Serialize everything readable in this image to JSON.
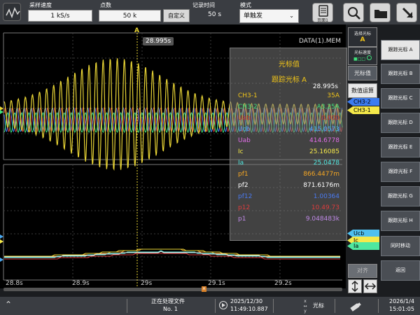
{
  "topbar": {
    "sample_rate": {
      "label": "采样速度",
      "value": "1 kS/s"
    },
    "points": {
      "label": "点数",
      "value": "50 k"
    },
    "custom_label": "自定义",
    "record_time": {
      "label": "记录时间",
      "value": "50 s"
    },
    "mode": {
      "label": "模式",
      "value": "单触发"
    },
    "page_button_label": "页面1"
  },
  "scope": {
    "filename": "DATA(1).MEM",
    "cursor_marker": "A",
    "cursor_time": "28.995s",
    "time_ticks": [
      "28.8s",
      "28.9s",
      "29s",
      "29.1s",
      "29.2s"
    ],
    "right_tags_top": [
      "CH3-2",
      "CH3-1"
    ],
    "right_tags_bottom": [
      "Ucb",
      "Ic",
      "Ia"
    ],
    "scroll_marker": "A"
  },
  "popup": {
    "title": "光标值",
    "subtitle": "跟踪光标 A",
    "time": "28.995s",
    "rows": [
      {
        "name": "CH3-1",
        "value": "35A",
        "color": "#f0c419"
      },
      {
        "name": "CH3-2",
        "value": "A3.25A",
        "color": "#3fe07a"
      },
      {
        "name": "Uab",
        "value": "0.000",
        "color": "#c0392b"
      },
      {
        "name": "Ucb",
        "value": "415.0573",
        "color": "#4aa8f0"
      },
      {
        "name": "Uab",
        "value": "414.6778",
        "color": "#e26de8"
      },
      {
        "name": "Ic",
        "value": "25.16085",
        "color": "#f5e94a"
      },
      {
        "name": "Ia",
        "value": "25.0478",
        "color": "#4fe8e0"
      },
      {
        "name": "pf1",
        "value": "866.4477m",
        "color": "#f5a623"
      },
      {
        "name": "pf2",
        "value": "871.6176m",
        "color": "#ffffff"
      },
      {
        "name": "pf12",
        "value": "1.00364",
        "color": "#4a7af0"
      },
      {
        "name": "p12",
        "value": "10.49.73",
        "color": "#e03c3c"
      },
      {
        "name": "p1",
        "value": "9.048483k",
        "color": "#c08ae8"
      }
    ]
  },
  "mid_panel": {
    "select_cursor": {
      "label": "选择光标",
      "value": "A"
    },
    "cursor_speed": {
      "label": "光标速度"
    },
    "cursor_value": "光标值",
    "math": "数值运算",
    "align": "对齐"
  },
  "side_buttons": [
    "跟踪光标 A",
    "跟踪光标 B",
    "跟踪光标 C",
    "跟踪光标 D",
    "跟踪光标 E",
    "跟踪光标 F",
    "跟踪光标 G",
    "跟踪光标 H",
    "同时移动",
    "返回"
  ],
  "bottombar": {
    "status": "正在处理文件",
    "file_no": "No. 1",
    "trigger_date": "2025/12/30",
    "trigger_time": "11:49:10.887",
    "cursor_mode": "光标",
    "clock_date": "2026/1/4",
    "clock_time": "15:01:05"
  },
  "colors": {
    "ch_yellow": "#e8d435",
    "ch_red": "#e03c3c",
    "ch_blue": "#3c7cf0",
    "ch_green": "#3fe07a",
    "ch_orange": "#f0a030",
    "ch_cyan": "#4fe8e0"
  }
}
